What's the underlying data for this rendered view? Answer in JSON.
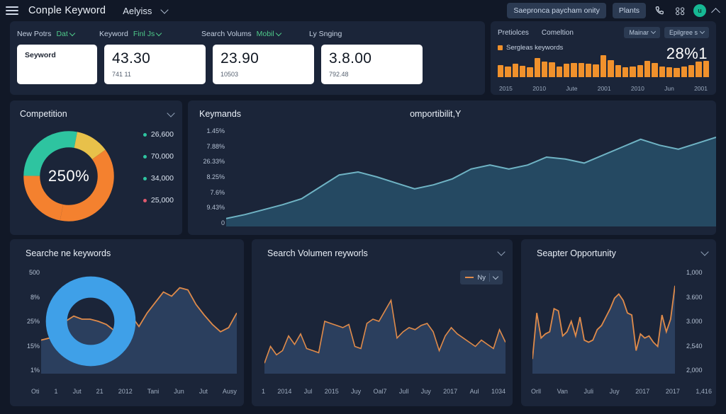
{
  "header": {
    "menu_icon": "hamburger-icon",
    "title": "Conple Keyword",
    "subtitle": "Aelyiss",
    "dropdown_icon": "chevron-down-icon",
    "pill_primary": "Saepronca paycham onity",
    "pill_secondary": "Plants",
    "phone_icon": "phone-icon",
    "apps_icon": "apps-grid-icon",
    "avatar_initial": "u",
    "collapse_icon": "chevron-up-icon"
  },
  "kpi": {
    "labels": [
      {
        "text": "New Potrs",
        "dropdown": "Dat"
      },
      {
        "text": "Keyword",
        "dropdown": "Finl Js"
      },
      {
        "text": "Search Volums",
        "dropdown": "Mobil"
      },
      {
        "text": "Ly Snging",
        "dropdown": ""
      }
    ],
    "search_value": "Seyword",
    "cards": [
      {
        "value": "43.30",
        "sub": "741 11"
      },
      {
        "value": "23.90",
        "sub": "10503"
      },
      {
        "value": "3.8.00",
        "sub": "792.48"
      }
    ]
  },
  "header_chart": {
    "tabs": [
      "Pretiolces",
      "Comeltion"
    ],
    "buttons": [
      "Mainar",
      "Epilgree s"
    ],
    "legend": "Sergleas keywords",
    "percent": "28%1",
    "chart_data": {
      "type": "bar",
      "title": "Sergleas keywords",
      "categories": [
        "2015",
        "2010",
        "Jute",
        "2001",
        "2010",
        "Jun",
        "2001"
      ],
      "tick_labels": [
        "2015",
        "2010",
        "Jute",
        "2001",
        "2010",
        "Jun",
        "2001"
      ],
      "values": [
        52,
        46,
        58,
        50,
        44,
        84,
        70,
        66,
        48,
        60,
        64,
        62,
        58,
        56,
        96,
        74,
        52,
        44,
        48,
        54,
        72,
        62,
        46,
        44,
        42,
        46,
        52,
        68,
        72
      ],
      "color": "#f0912c",
      "ylim": [
        0,
        100
      ],
      "grid": false,
      "legend_position": "top-left"
    }
  },
  "competition": {
    "title": "Competition",
    "center_label": "250%",
    "collapse_icon": "chevron-down-icon",
    "chart_data": {
      "type": "pie",
      "title": "Competition",
      "center_text": "250%",
      "labels": [
        "26,600",
        "70,000",
        "34,000",
        "25,000"
      ],
      "values": [
        28,
        12,
        38,
        22
      ],
      "colors": [
        "#2ec4a0",
        "#e8c14a",
        "#f4812f",
        "#f4812f"
      ],
      "legend_position": "right"
    }
  },
  "keyword_area": {
    "title_left": "Keymands",
    "title_right": "omportibilit,Y",
    "chart_data": {
      "type": "area",
      "title": "Keymands",
      "ylabel": "",
      "xlabel": "",
      "ytick_labels": [
        "1.45%",
        "7.88%",
        "26.33%",
        "8.25%",
        "7.6%",
        "9.43%",
        "0"
      ],
      "line_color": "#6fb3c4",
      "fill_color": "#27506a",
      "grid": false,
      "values": [
        8,
        12,
        17,
        22,
        28,
        40,
        52,
        55,
        50,
        44,
        38,
        42,
        48,
        58,
        62,
        58,
        62,
        70,
        68,
        64,
        72,
        80,
        88,
        82,
        78,
        84,
        90
      ]
    }
  },
  "panel_searchene": {
    "title": "Searche ne keywords",
    "chart_data": {
      "type": "line",
      "title": "Searche ne keywords",
      "ytick_labels": [
        "500",
        "8%",
        "25%",
        "15%",
        "1%"
      ],
      "xtick_labels": [
        "Oti",
        "1",
        "Jut",
        "21",
        "2012",
        "Tani",
        "Jun",
        "Jut",
        "Ausy"
      ],
      "line_color": "#e08b4a",
      "area_color": "#2b3f5e",
      "donut_color": "#3fa0e8",
      "values": [
        32,
        34,
        33,
        50,
        55,
        52,
        52,
        50,
        47,
        41,
        44,
        56,
        45,
        58,
        68,
        78,
        74,
        82,
        80,
        66,
        56,
        47,
        40,
        44,
        58
      ]
    }
  },
  "panel_volumen": {
    "title": "Search Volumen reyworls",
    "collapse_icon": "chevron-down-icon",
    "series_button": "Ny",
    "chart_data": {
      "type": "area",
      "title": "Search Volumen reyworls",
      "xtick_labels": [
        "1",
        "2014",
        "Jul",
        "2015",
        "Juy",
        "Oal7",
        "Jull",
        "Juy",
        "2017",
        "Aul",
        "1034"
      ],
      "line_color": "#e08b4a",
      "area_color": "#2b3f5e",
      "values": [
        10,
        26,
        18,
        22,
        36,
        28,
        38,
        24,
        22,
        20,
        50,
        48,
        46,
        44,
        47,
        26,
        24,
        48,
        52,
        50,
        60,
        70,
        34,
        40,
        44,
        42,
        46,
        48,
        40,
        22,
        36,
        44,
        38,
        34,
        30,
        26,
        32,
        28,
        24,
        42,
        30
      ]
    }
  },
  "panel_opportunity": {
    "title": "Seapter Opportunity",
    "collapse_icon": "chevron-down-icon",
    "chart_data": {
      "type": "area",
      "title": "Seapter Opportunity",
      "ytick_labels": [
        "1,000",
        "3.600",
        "3.000",
        "2,540",
        "2,000"
      ],
      "xtick_labels": [
        "Orll",
        "Van",
        "Juli",
        "Juy",
        "2017",
        "2017",
        "1,416"
      ],
      "line_color": "#e08b4a",
      "area_color": "#2b3f5e",
      "values": [
        14,
        58,
        34,
        38,
        40,
        62,
        60,
        36,
        40,
        50,
        36,
        54,
        32,
        30,
        32,
        42,
        46,
        54,
        62,
        72,
        76,
        70,
        58,
        56,
        22,
        38,
        34,
        36,
        30,
        26,
        56,
        40,
        52,
        84
      ]
    }
  }
}
